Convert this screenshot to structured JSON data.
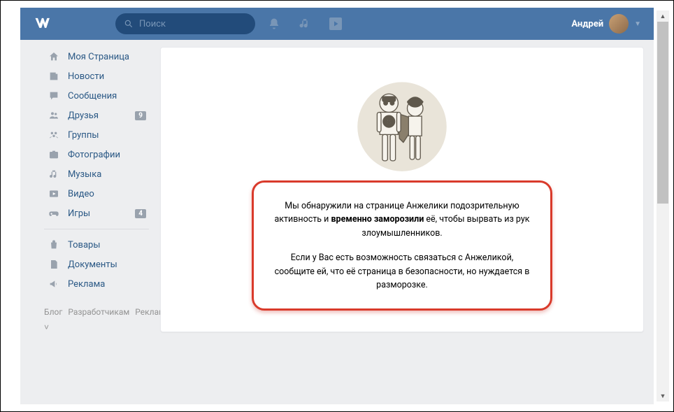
{
  "header": {
    "search_placeholder": "Поиск",
    "user_name": "Андрей"
  },
  "sidebar": {
    "items": [
      {
        "icon": "home",
        "label": "Моя Страница",
        "badge": ""
      },
      {
        "icon": "news",
        "label": "Новости",
        "badge": ""
      },
      {
        "icon": "msg",
        "label": "Сообщения",
        "badge": ""
      },
      {
        "icon": "friends",
        "label": "Друзья",
        "badge": "9"
      },
      {
        "icon": "groups",
        "label": "Группы",
        "badge": ""
      },
      {
        "icon": "photos",
        "label": "Фотографии",
        "badge": ""
      },
      {
        "icon": "music",
        "label": "Музыка",
        "badge": ""
      },
      {
        "icon": "video",
        "label": "Видео",
        "badge": ""
      },
      {
        "icon": "games",
        "label": "Игры",
        "badge": "4"
      }
    ],
    "items2": [
      {
        "icon": "shop",
        "label": "Товары"
      },
      {
        "icon": "docs",
        "label": "Документы"
      },
      {
        "icon": "ads",
        "label": "Реклама"
      }
    ],
    "footer": [
      "Блог",
      "Разработчикам",
      "Реклама",
      "Ещё ˅"
    ]
  },
  "notice": {
    "line1a": "Мы обнаружили на странице Анжелики подозрительную активность и ",
    "line1b": "временно заморозили",
    "line1c": " её, чтобы вырвать из рук злоумышленников.",
    "line2": "Если у Вас есть возможность связаться с Анжеликой, сообщите ей, что её страница в безопасности, но нуждается в разморозке."
  }
}
